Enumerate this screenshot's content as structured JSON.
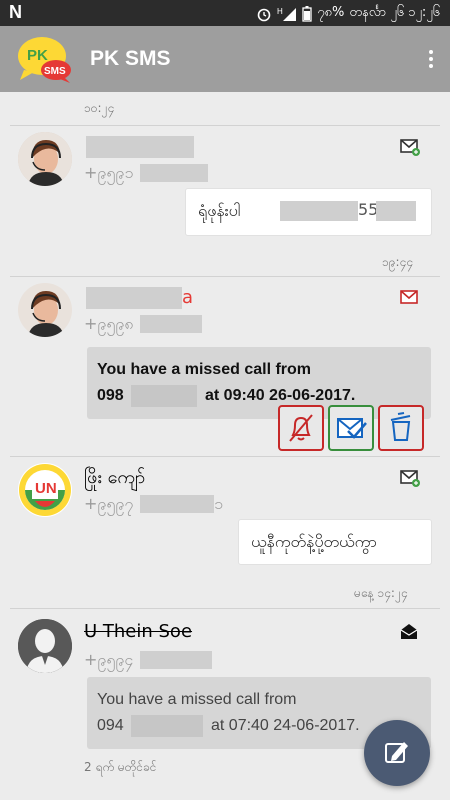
{
  "status_bar": {
    "network_letter": "N",
    "battery_percent": "၇၈%",
    "clock": "တနင်္လာ ၂၆ ၁၂:၂၆"
  },
  "app": {
    "title": "PK SMS",
    "logo_top": "PK",
    "logo_bottom": "SMS"
  },
  "threads": [
    {
      "time_top": "၁၀:၂၄"
    },
    {
      "number_prefix": "+၉၅၉၁",
      "message_prefix": "ရုံဖုန်းပါ",
      "message_suffix": "55",
      "time": "၁၉:၄၄",
      "icon": "envelope-new-icon"
    },
    {
      "name_suffix": "a",
      "number_prefix": "+၉၅၉၈",
      "line1": "You have  a missed call from",
      "line2_prefix": "098",
      "line2_suffix": "at 09:40 26-06-2017.",
      "icon": "envelope-unread-icon"
    },
    {
      "name": "ဖြိုး ကျော်",
      "number_prefix": "+၉၅၉၇",
      "number_suffix": "၁",
      "message": "ယူနီကုတ်နဲ့ပို့တယ်ကွာ",
      "time": "မနေ့ ၁၄:၂၄",
      "icon": "envelope-new-icon"
    },
    {
      "name": "U Thein Soe",
      "number_prefix": "+၉၅၉၄",
      "line1": "You have  a missed call from",
      "line2_prefix": "094",
      "line2_suffix": "at 07:40 24-06-2017.",
      "footer": "2 ရက် မတိုင်ခင်",
      "icon": "envelope-open-icon"
    }
  ],
  "colors": {
    "appbar": "#9e9e9e",
    "fab": "#4b5a73",
    "red": "#c62828",
    "green": "#388e3c"
  }
}
